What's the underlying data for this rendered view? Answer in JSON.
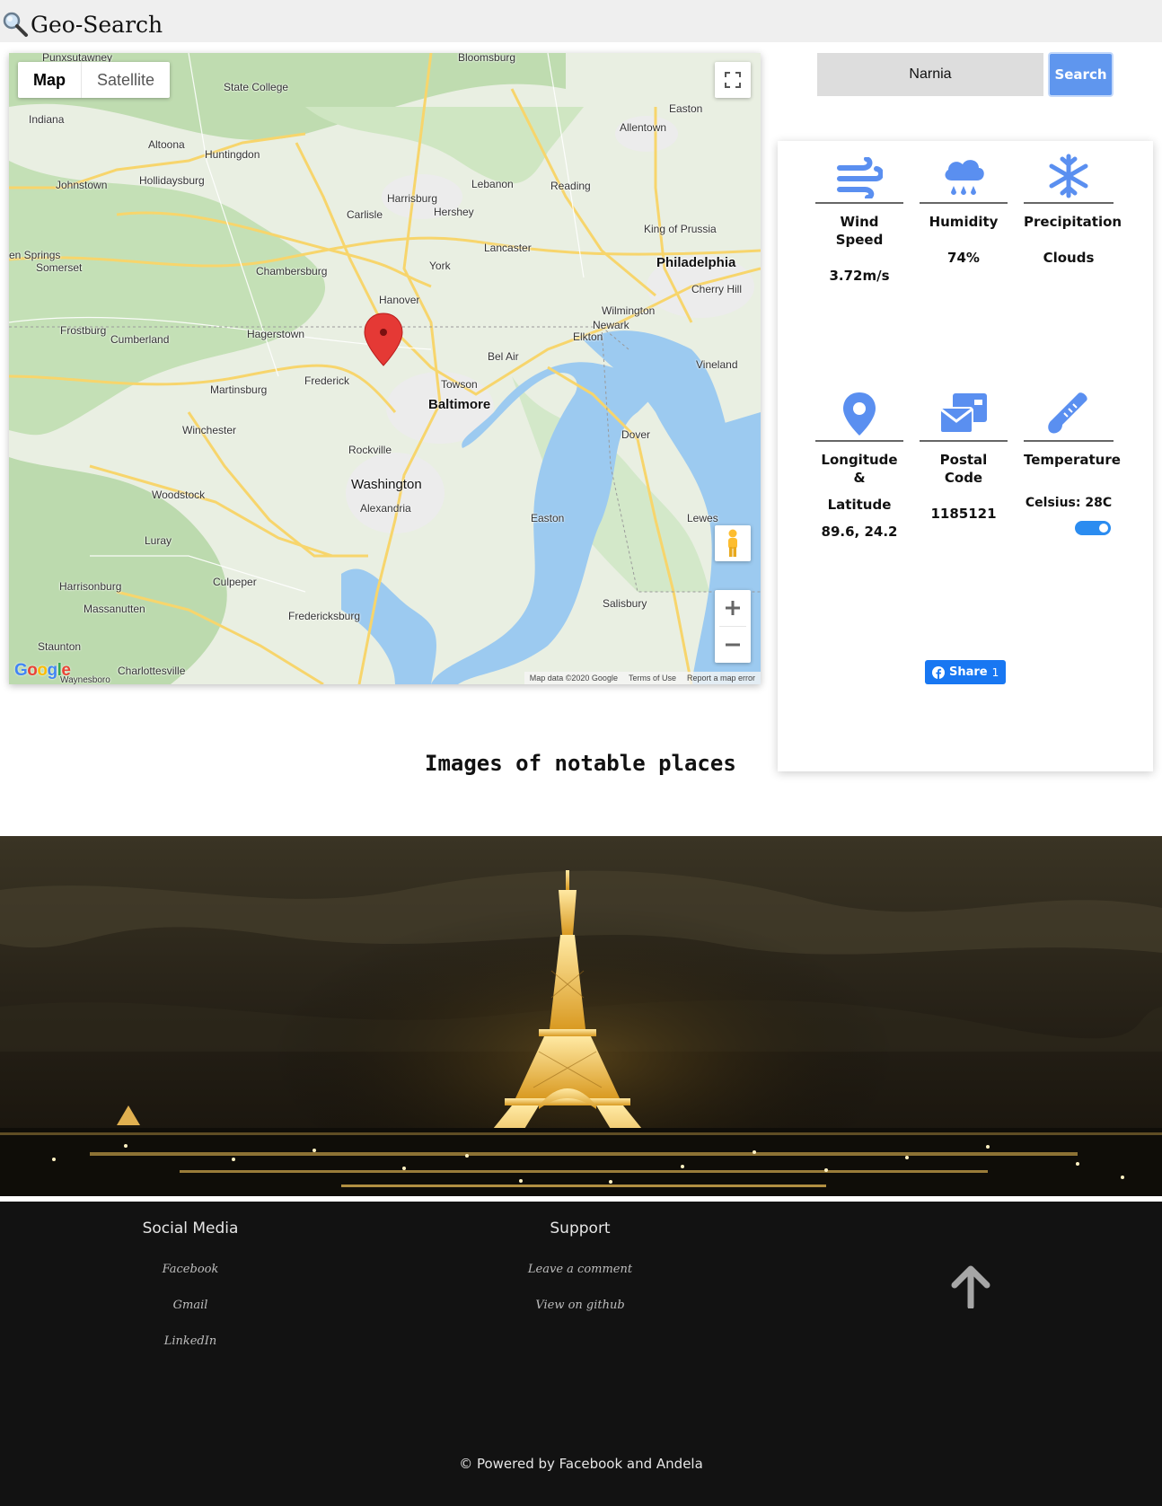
{
  "app": {
    "title": "Geo-Search"
  },
  "map": {
    "type_map": "Map",
    "type_satellite": "Satellite",
    "credit_data": "Map data ©2020 Google",
    "credit_terms": "Terms of Use",
    "credit_report": "Report a map error",
    "places": {
      "punxsutawney": "Punxsutawney",
      "bloomsburg": "Bloomsburg",
      "state_college": "State College",
      "easton": "Easton",
      "indiana": "Indiana",
      "altoona": "Altoona",
      "huntingdon": "Huntingdon",
      "allentown": "Allentown",
      "hollidaysburg": "Hollidaysburg",
      "johnstown": "Johnstown",
      "lebanon": "Lebanon",
      "reading": "Reading",
      "harrisburg": "Harrisburg",
      "hershey": "Hershey",
      "carlisle": "Carlisle",
      "king_of_prussia": "King of Prussia",
      "lancaster": "Lancaster",
      "philadelphia": "Philadelphia",
      "glen_springs": "en Springs",
      "somerset": "Somerset",
      "york": "York",
      "chambersburg": "Chambersburg",
      "cherry_hill": "Cherry Hill",
      "hanover": "Hanover",
      "wilmington": "Wilmington",
      "newark": "Newark",
      "frostburg": "Frostburg",
      "cumberland": "Cumberland",
      "hagerstown": "Hagerstown",
      "elkton": "Elkton",
      "bel_air": "Bel Air",
      "vineland": "Vineland",
      "frederick": "Frederick",
      "towson": "Towson",
      "martinsburg": "Martinsburg",
      "baltimore": "Baltimore",
      "winchester": "Winchester",
      "dover": "Dover",
      "rockville": "Rockville",
      "washington": "Washington",
      "alexandria": "Alexandria",
      "woodstock": "Woodstock",
      "luray": "Luray",
      "lewes": "Lewes",
      "culpeper": "Culpeper",
      "harrisonburg": "Harrisonburg",
      "salisbury": "Salisbury",
      "massanutten": "Massanutten",
      "fredericksburg": "Fredericksburg",
      "staunton": "Staunton",
      "charlottesville": "Charlottesville",
      "waynesboro": "Waynesboro",
      "easton_md": "Easton"
    }
  },
  "search": {
    "value": "Narnia",
    "button_label": "Search"
  },
  "weather": {
    "wind_label": "Wind Speed",
    "wind_value": "3.72m/s",
    "humidity_label": "Humidity",
    "humidity_value": "74%",
    "precip_label": "Precipitation",
    "precip_value": "Clouds",
    "coords_label_1": "Longitude &",
    "coords_label_2": "Latitude",
    "coords_value": "89.6, 24.2",
    "postal_label": "Postal Code",
    "postal_value": "1185121",
    "temp_label": "Temperature",
    "temp_value": "Celsius: 28C",
    "unit_toggle_on": true,
    "share_label": "Share",
    "share_count": "1"
  },
  "section": {
    "title": "Images of notable places"
  },
  "footer": {
    "social_title": "Social Media",
    "social_links": [
      "Facebook",
      "Gmail",
      "LinkedIn"
    ],
    "support_title": "Support",
    "support_links": [
      "Leave a comment",
      "View on github"
    ],
    "copyright": "© Powered by Facebook and Andela"
  },
  "colors": {
    "accent": "#5f96ee",
    "icon_blue": "#5a8ff0",
    "facebook": "#1877f2",
    "footer_bg": "#121212",
    "map_pin": "#e53935"
  }
}
